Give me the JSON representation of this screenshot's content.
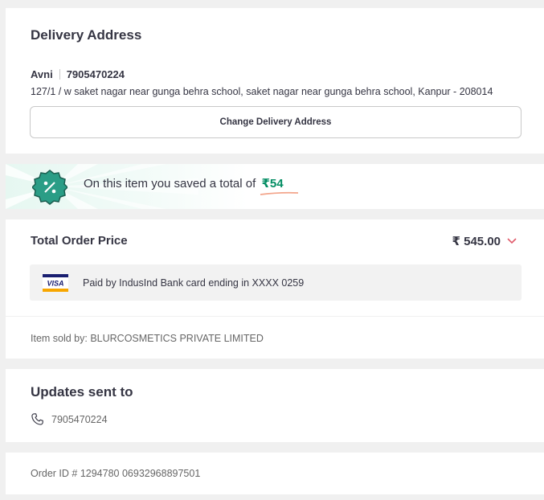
{
  "delivery": {
    "title": "Delivery Address",
    "name": "Avni",
    "phone": "7905470224",
    "address": "127/1 / w saket nagar near gunga behra school, saket nagar near gunga behra school, Kanpur - 208014",
    "change_label": "Change Delivery Address"
  },
  "savings": {
    "icon": "discount-badge-icon",
    "message": "On this item you saved a total of",
    "amount": "₹54",
    "accent_color": "#038d63"
  },
  "price": {
    "title": "Total Order Price",
    "total": "₹ 545.00",
    "payment_icon": "visa-card-icon",
    "payment_text": "Paid by IndusInd Bank card ending in XXXX 0259"
  },
  "seller": {
    "text": "Item sold by: BLURCOSMETICS PRIVATE LIMITED"
  },
  "updates": {
    "title": "Updates sent to",
    "icon": "phone-icon",
    "phone": "7905470224"
  },
  "order": {
    "text": "Order ID # 1294780 06932968897501"
  }
}
